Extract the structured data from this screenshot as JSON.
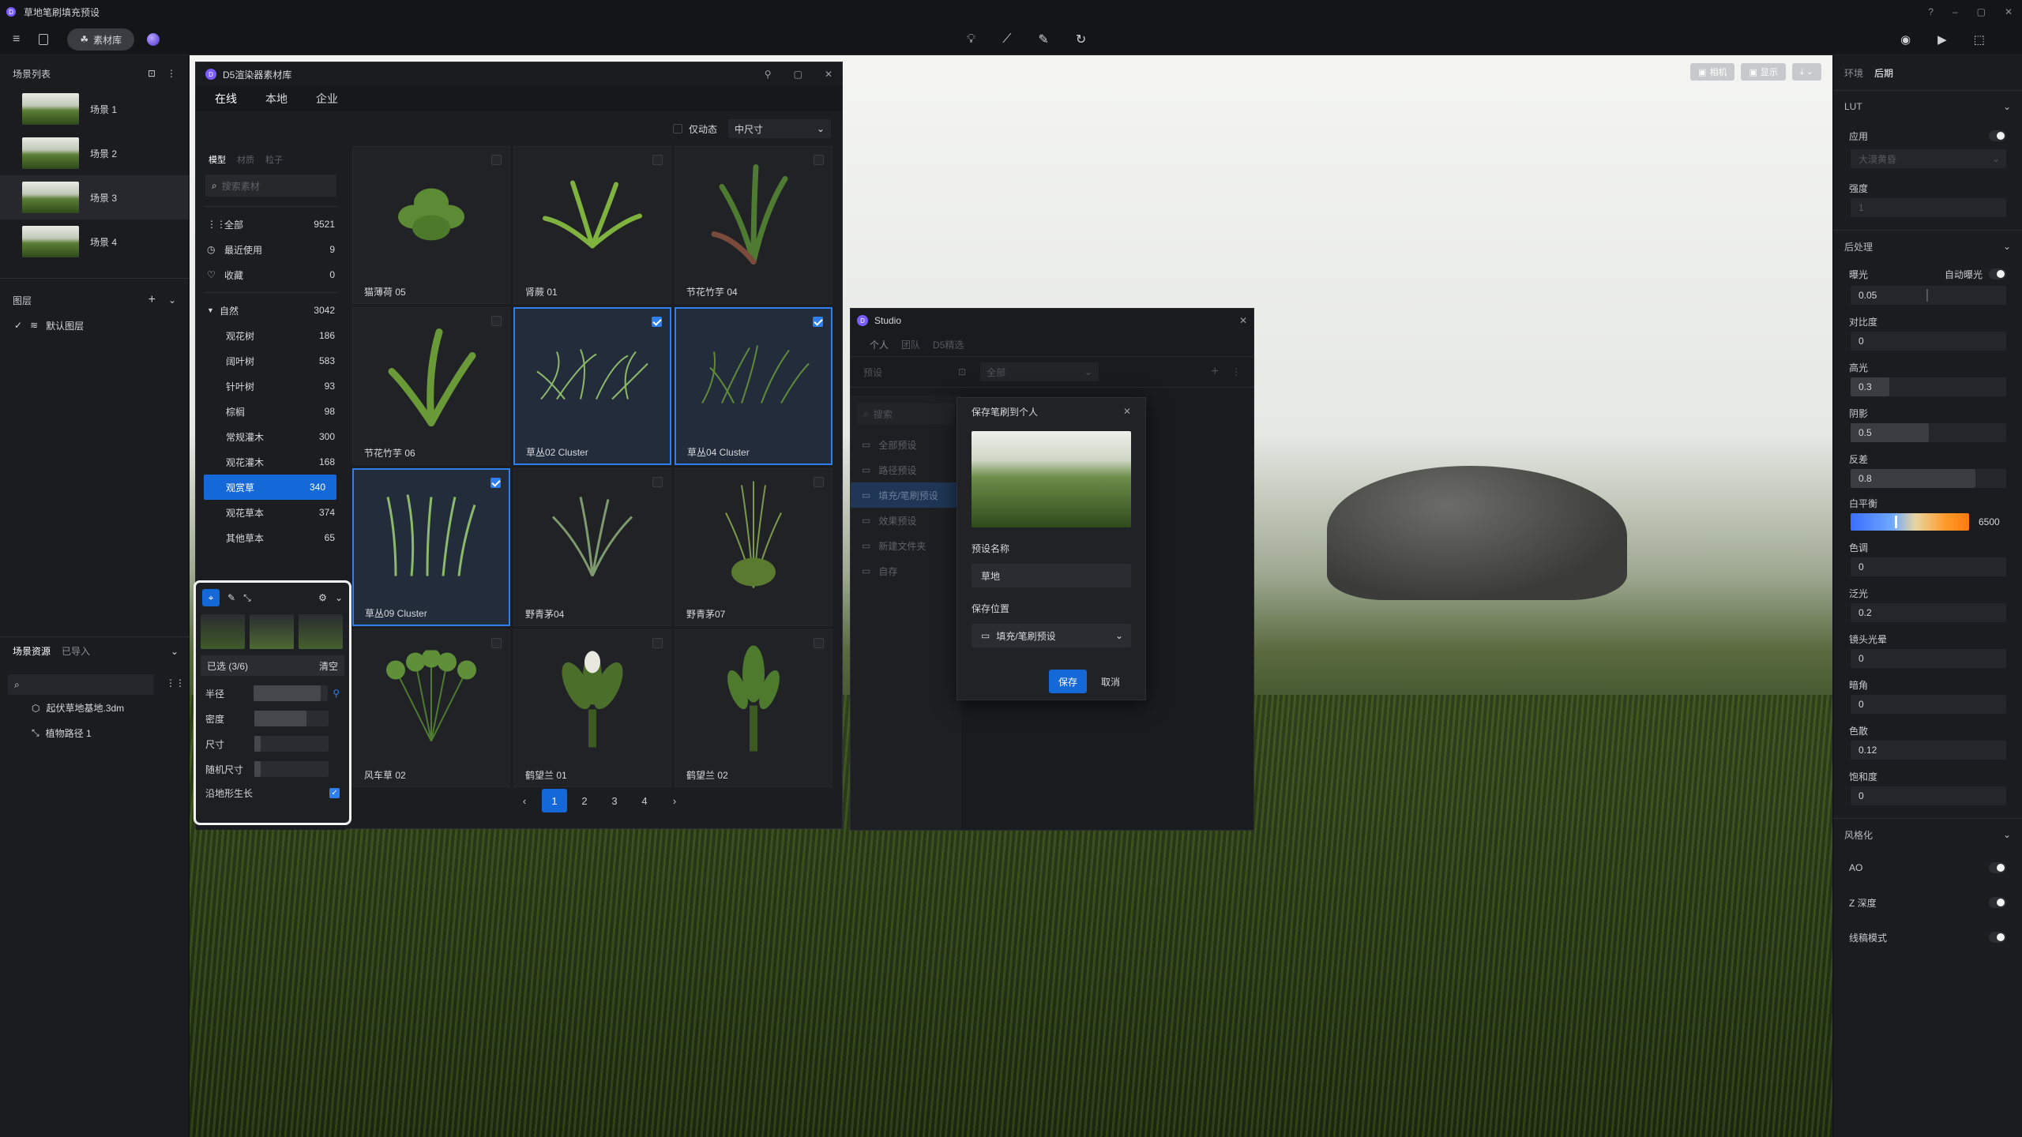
{
  "app": {
    "title": "草地笔刷填充预设",
    "material_lib_btn": "素材库"
  },
  "leftpanel": {
    "scene_list_title": "场景列表",
    "scenes": [
      {
        "label": "场景 1"
      },
      {
        "label": "场景 2"
      },
      {
        "label": "场景 3"
      },
      {
        "label": "场景 4"
      }
    ],
    "layers_title": "图层",
    "default_layer": "默认图层",
    "resources_tab": "场景资源",
    "imported_tab": "已导入",
    "resource_items": [
      "起伏草地基地.3dm",
      "植物路径 1"
    ]
  },
  "assetwin": {
    "title": "D5渲染器素材库",
    "tabs": [
      "在线",
      "本地",
      "企业"
    ],
    "only_animated": "仅动态",
    "size_select": "中尺寸",
    "subtabs": [
      "模型",
      "材质",
      "粒子"
    ],
    "search_placeholder": "搜索素材",
    "quick": [
      {
        "label": "全部",
        "count": "9521"
      },
      {
        "label": "最近使用",
        "count": "9"
      },
      {
        "label": "收藏",
        "count": "0"
      }
    ],
    "nature": {
      "label": "自然",
      "count": "3042"
    },
    "subcats": [
      {
        "label": "观花树",
        "count": "186"
      },
      {
        "label": "阔叶树",
        "count": "583"
      },
      {
        "label": "针叶树",
        "count": "93"
      },
      {
        "label": "棕榈",
        "count": "98"
      },
      {
        "label": "常规灌木",
        "count": "300"
      },
      {
        "label": "观花灌木",
        "count": "168"
      },
      {
        "label": "观赏草",
        "count": "340"
      },
      {
        "label": "观花草本",
        "count": "374"
      },
      {
        "label": "其他草本",
        "count": "65"
      }
    ],
    "assets": [
      {
        "name": "猫薄荷 05",
        "selected": false
      },
      {
        "name": "肾蕨 01",
        "selected": false
      },
      {
        "name": "节花竹芋 04",
        "selected": false
      },
      {
        "name": "节花竹芋 06",
        "selected": false
      },
      {
        "name": "草丛02 Cluster",
        "selected": true
      },
      {
        "name": "草丛04 Cluster",
        "selected": true
      },
      {
        "name": "草丛09 Cluster",
        "selected": true
      },
      {
        "name": "野青茅04",
        "selected": false
      },
      {
        "name": "野青茅07",
        "selected": false
      },
      {
        "name": "风车草 02",
        "selected": false
      },
      {
        "name": "鹤望兰 01",
        "selected": false
      },
      {
        "name": "鹤望兰 02",
        "selected": false
      }
    ],
    "pages": [
      "1",
      "2",
      "3",
      "4"
    ],
    "prev": "‹",
    "next": "›"
  },
  "brush": {
    "selected": "已选 (3/6)",
    "clear": "清空",
    "params": [
      {
        "label": "半径",
        "value": 0.9
      },
      {
        "label": "密度",
        "value": 0.7
      },
      {
        "label": "尺寸",
        "value": 0.08
      },
      {
        "label": "随机尺寸",
        "value": 0.08
      }
    ],
    "terrain": "沿地形生长"
  },
  "studio": {
    "title": "Studio",
    "tabs": [
      "个人",
      "团队",
      "D5精选"
    ],
    "preset_label": "预设",
    "filter": "全部",
    "search": "搜索",
    "items": [
      "全部预设",
      "路径预设",
      "填充/笔刷预设",
      "效果预设",
      "新建文件夹",
      "自存"
    ]
  },
  "savedlg": {
    "title": "保存笔刷到个人",
    "name_label": "预设名称",
    "name_value": "草地",
    "loc_label": "保存位置",
    "loc_value": "填充/笔刷预设",
    "save": "保存",
    "cancel": "取消"
  },
  "viewport": {
    "camera": "相机",
    "display": "显示"
  },
  "rightpanel": {
    "tabs": [
      "环境",
      "后期"
    ],
    "lut": "LUT",
    "apply": "应用",
    "lut_preset": "大漠黄昏",
    "intensity": "强度",
    "intensity_value": "1",
    "post": "后处理",
    "exposure": "曝光",
    "auto_exposure": "自动曝光",
    "exposure_value": "0.05",
    "fields": [
      {
        "label": "对比度",
        "value": "0",
        "fill": 0
      },
      {
        "label": "高光",
        "value": "0.3",
        "fill": 0.25
      },
      {
        "label": "阴影",
        "value": "0.5",
        "fill": 0.5
      },
      {
        "label": "反差",
        "value": "0.8",
        "fill": 0.8
      }
    ],
    "wb": "白平衡",
    "wb_value": "6500",
    "fields2": [
      {
        "label": "色调",
        "value": "0"
      },
      {
        "label": "泛光",
        "value": "0.2"
      },
      {
        "label": "镜头光晕",
        "value": "0"
      },
      {
        "label": "暗角",
        "value": "0"
      },
      {
        "label": "色散",
        "value": "0.12"
      },
      {
        "label": "饱和度",
        "value": "0"
      }
    ],
    "style": "风格化",
    "ao": "AO",
    "zdepth": "Z 深度",
    "wire": "线稿模式"
  }
}
